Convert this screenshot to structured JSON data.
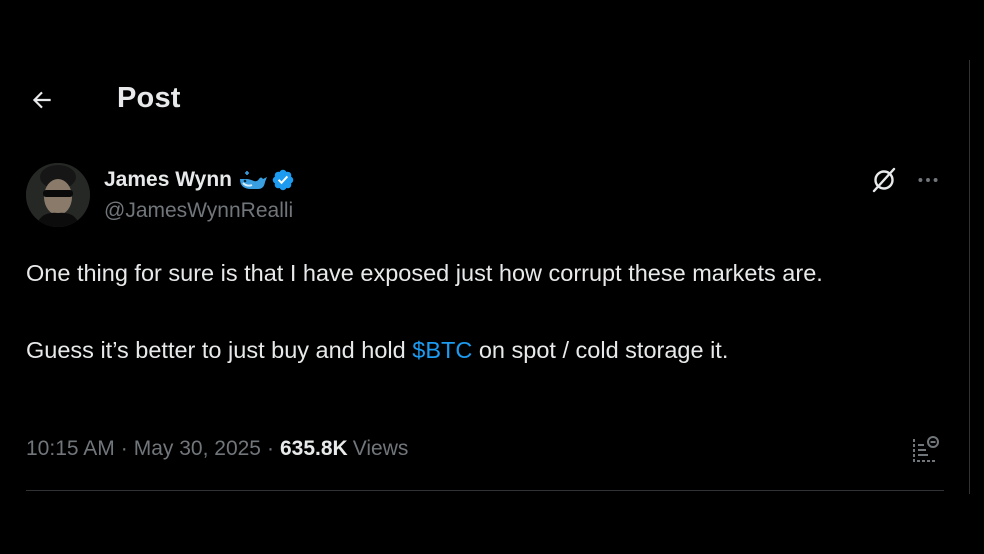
{
  "header": {
    "title": "Post"
  },
  "post": {
    "author": {
      "display_name": "James Wynn",
      "handle": "@JamesWynnRealli"
    },
    "text": {
      "paragraph_1": "One thing for sure is that I have exposed just how corrupt these markets are.",
      "paragraph_2_before": "Guess it’s better to just buy and hold ",
      "cashtag": "$BTC",
      "paragraph_2_after": " on spot / cold storage it."
    },
    "meta": {
      "time": "10:15 AM",
      "separator": "·",
      "date": "May 30, 2025",
      "views_count": "635.8K",
      "views_label": "Views"
    }
  },
  "colors": {
    "background": "#000000",
    "text": "#e7e9ea",
    "secondary_text": "#71767b",
    "accent": "#1d9bf0",
    "divider": "#2f3336"
  },
  "icons": {
    "back": "arrow-left-icon",
    "whale": "whale-emoji-icon",
    "verified": "verified-badge-icon",
    "grok": "grok-icon",
    "more": "more-horizontal-icon",
    "analytics": "analytics-icon"
  }
}
